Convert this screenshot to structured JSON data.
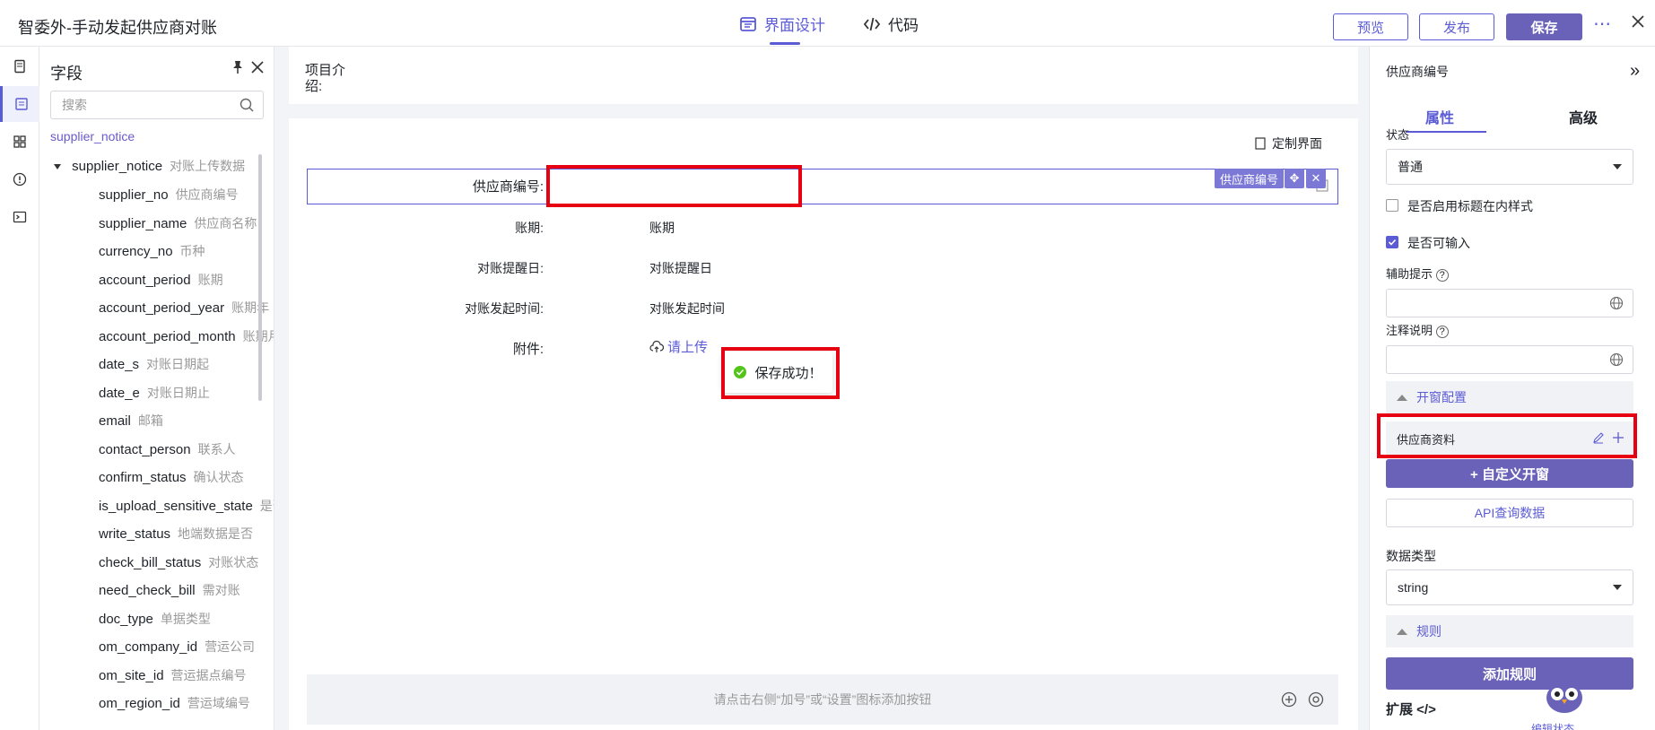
{
  "header": {
    "title": "智委外-手动发起供应商对账",
    "tab_design": "界面设计",
    "tab_code": "代码",
    "preview_label": "预览",
    "publish_label": "发布",
    "save_label": "保存"
  },
  "field_panel": {
    "title": "字段",
    "search_placeholder": "搜索",
    "root": "supplier_notice",
    "group": {
      "name": "supplier_notice",
      "desc": "对账上传数据"
    },
    "fields": [
      {
        "name": "supplier_no",
        "desc": "供应商编号"
      },
      {
        "name": "supplier_name",
        "desc": "供应商名称"
      },
      {
        "name": "currency_no",
        "desc": "币种"
      },
      {
        "name": "account_period",
        "desc": "账期"
      },
      {
        "name": "account_period_year",
        "desc": "账期年"
      },
      {
        "name": "account_period_month",
        "desc": "账期月"
      },
      {
        "name": "date_s",
        "desc": "对账日期起"
      },
      {
        "name": "date_e",
        "desc": "对账日期止"
      },
      {
        "name": "email",
        "desc": "邮箱"
      },
      {
        "name": "contact_person",
        "desc": "联系人"
      },
      {
        "name": "confirm_status",
        "desc": "确认状态"
      },
      {
        "name": "is_upload_sensitive_state",
        "desc": "是否"
      },
      {
        "name": "write_status",
        "desc": "地端数据是否"
      },
      {
        "name": "check_bill_status",
        "desc": "对账状态"
      },
      {
        "name": "need_check_bill",
        "desc": "需对账"
      },
      {
        "name": "doc_type",
        "desc": "单据类型"
      },
      {
        "name": "om_company_id",
        "desc": "营运公司"
      },
      {
        "name": "om_site_id",
        "desc": "营运据点编号"
      },
      {
        "name": "om_region_id",
        "desc": "营运域编号"
      }
    ]
  },
  "canvas": {
    "intro_label": "项目介绍:",
    "custom_page": "定制界面",
    "selected_tag": "供应商编号",
    "form": [
      {
        "label": "供应商编号:",
        "value": ""
      },
      {
        "label": "账期:",
        "value": "账期"
      },
      {
        "label": "对账提醒日:",
        "value": "对账提醒日"
      },
      {
        "label": "对账发起时间:",
        "value": "对账发起时间"
      },
      {
        "label": "附件:",
        "value": "请上传"
      }
    ],
    "toast": "保存成功！",
    "bottom_hint": "请点击右侧“加号”或“设置”图标添加按钮"
  },
  "props": {
    "title": "供应商编号",
    "tab_attr": "属性",
    "tab_adv": "高级",
    "status_label": "状态",
    "status_value": "普通",
    "inline_title_label": "是否启用标题在内样式",
    "inputable_label": "是否可输入",
    "hint_label": "辅助提示",
    "note_label": "注释说明",
    "popup_section": "开窗配置",
    "popup_item": "供应商资料",
    "custom_popup_btn": "+ 自定义开窗",
    "api_btn": "API查询数据",
    "data_type_label": "数据类型",
    "data_type_value": "string",
    "rules_section": "规则",
    "add_rule_btn": "添加规则",
    "extend_label": "扩展 </>",
    "edit_status": "编辑状态"
  },
  "colors": {
    "accent": "#5b5bd6",
    "highlight": "#e60012",
    "success": "#52c41a"
  }
}
